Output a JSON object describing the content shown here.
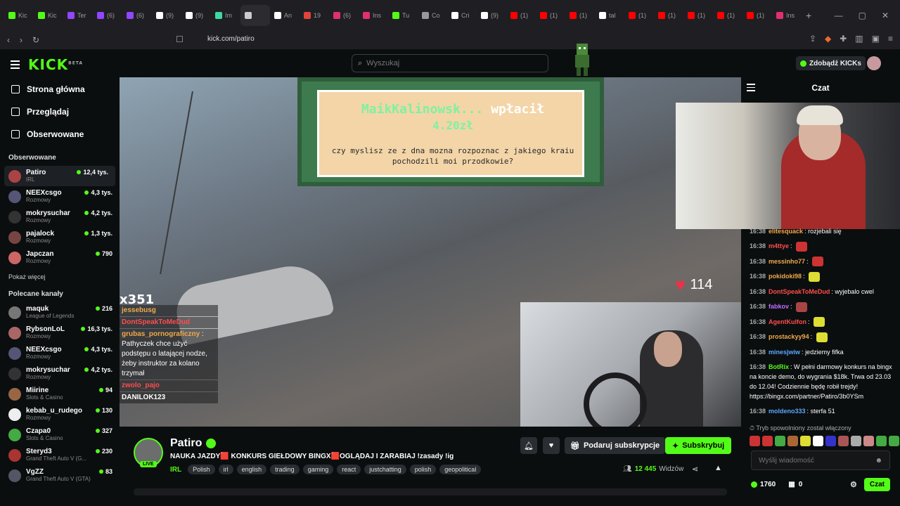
{
  "browser": {
    "tabs": [
      {
        "label": "Kic",
        "color": "#53fc18"
      },
      {
        "label": "Kic",
        "color": "#53fc18"
      },
      {
        "label": "Ter",
        "color": "#9146ff"
      },
      {
        "label": "(6)",
        "color": "#9146ff"
      },
      {
        "label": "(6)",
        "color": "#9146ff"
      },
      {
        "label": "(9)",
        "color": "#ffffff"
      },
      {
        "label": "(9)",
        "color": "#ffffff"
      },
      {
        "label": "Im",
        "color": "#3dd9a0"
      },
      {
        "label": "",
        "color": "#cccccc"
      },
      {
        "label": "An",
        "color": "#ffffff"
      },
      {
        "label": "19",
        "color": "#e0443b"
      },
      {
        "label": "(6)",
        "color": "#e1306c"
      },
      {
        "label": "Ins",
        "color": "#e1306c"
      },
      {
        "label": "Tu",
        "color": "#53fc18"
      },
      {
        "label": "Co",
        "color": "#999999"
      },
      {
        "label": "Cri",
        "color": "#ffffff"
      },
      {
        "label": "(9)",
        "color": "#ffffff"
      },
      {
        "label": "(1)",
        "color": "#ff0000"
      },
      {
        "label": "(1)",
        "color": "#ff0000"
      },
      {
        "label": "(1)",
        "color": "#ff0000"
      },
      {
        "label": "tal",
        "color": "#ffffff"
      },
      {
        "label": "(1)",
        "color": "#ff0000"
      },
      {
        "label": "(1)",
        "color": "#ff0000"
      },
      {
        "label": "(1)",
        "color": "#ff0000"
      },
      {
        "label": "(1)",
        "color": "#ff0000"
      },
      {
        "label": "(1)",
        "color": "#ff0000"
      },
      {
        "label": "Ins",
        "color": "#e1306c"
      }
    ],
    "url": "kick.com/patiro"
  },
  "header": {
    "logo": "KICK",
    "logo_badge": "BETA",
    "search_placeholder": "Wyszukaj",
    "kicks_button": "Zdobądź KICKs"
  },
  "sidebar": {
    "nav": [
      {
        "label": "Strona główna",
        "icon": "home-icon"
      },
      {
        "label": "Przeglądaj",
        "icon": "browse-icon"
      },
      {
        "label": "Obserwowane",
        "icon": "heart-icon"
      }
    ],
    "followed_title": "Obserwowane",
    "followed": [
      {
        "name": "Patiro",
        "category": "IRL",
        "viewers": "12,4 tys.",
        "color": "#a44"
      },
      {
        "name": "NEEXcsgo",
        "category": "Rozmowy",
        "viewers": "4,3 tys.",
        "color": "#557"
      },
      {
        "name": "mokrysuchar",
        "category": "Rozmowy",
        "viewers": "4,2 tys.",
        "color": "#333"
      },
      {
        "name": "pajalock",
        "category": "Rozmowy",
        "viewers": "1,3 tys.",
        "color": "#744"
      },
      {
        "name": "Japczan",
        "category": "Rozmowy",
        "viewers": "790",
        "color": "#c66"
      }
    ],
    "show_more": "Pokaż więcej",
    "recommended_title": "Polecane kanały",
    "recommended": [
      {
        "name": "maquk",
        "category": "League of Legends",
        "viewers": "216",
        "color": "#777"
      },
      {
        "name": "RybsonLoL",
        "category": "Rozmowy",
        "viewers": "16,3 tys.",
        "color": "#a66"
      },
      {
        "name": "NEEXcsgo",
        "category": "Rozmowy",
        "viewers": "4,3 tys.",
        "color": "#557"
      },
      {
        "name": "mokrysuchar",
        "category": "Rozmowy",
        "viewers": "4,2 tys.",
        "color": "#333"
      },
      {
        "name": "Miirine",
        "category": "Slots & Casino",
        "viewers": "94",
        "color": "#964"
      },
      {
        "name": "kebab_u_rudego",
        "category": "Rozmowy",
        "viewers": "130",
        "color": "#eee"
      },
      {
        "name": "Czapa0",
        "category": "Slots & Casino",
        "viewers": "327",
        "color": "#4a4"
      },
      {
        "name": "Steryd3",
        "category": "Grand Theft Auto V (G...",
        "viewers": "230",
        "color": "#a33"
      },
      {
        "name": "VgZZ",
        "category": "Grand Theft Auto V (GTA)",
        "viewers": "83",
        "color": "#556"
      }
    ]
  },
  "video": {
    "alert_name": "MaikKalinowsk...",
    "alert_verb": "wpłacił",
    "alert_amount": "4.20zł",
    "alert_message": "czy myslisz ze z dna mozna rozpoznac z jakiego kraiu pochodzili moi przodkowie?",
    "heart_count": "114",
    "overlay_combo": "x351",
    "overlay_chat": [
      {
        "user": "jessebusg",
        "text": "",
        "user_color": "#f0a94a"
      },
      {
        "user": "DontSpeakToMeDud",
        "text": "",
        "user_color": "#ff4d4d"
      },
      {
        "user": "grubas_pornograficzny",
        "text": "Pathyczek chce użyć podstępu o latającej nodze, żeby instruktor za kolano trzymał",
        "user_color": "#f0a94a"
      },
      {
        "user": "zwolo_pajo",
        "text": "",
        "user_color": "#ff4d4d"
      },
      {
        "user": "DANILOK123",
        "text": "",
        "user_color": "#ffffff"
      }
    ]
  },
  "stream_info": {
    "channel": "Patiro",
    "live": "LIVE",
    "title": "NAUKA JAZDY🟥 KONKURS GIEŁDOWY BINGX🟥OGLĄDAJ I ZARABIAJ !zasady !ig",
    "category": "IRL",
    "tags": [
      "Polish",
      "irl",
      "english",
      "trading",
      "gaming",
      "react",
      "justchatting",
      "polish",
      "geopolitical"
    ],
    "gift_button": "Podaruj subskrypcje",
    "subscribe_button": "Subskrybuj",
    "viewers_count": "12 445",
    "viewers_label": "Widzów"
  },
  "chat": {
    "title": "Czat",
    "messages": [
      {
        "time": "16:38",
        "user": "elitesquack",
        "text": "rozjebali się",
        "color": "#f0a94a",
        "emote": ""
      },
      {
        "time": "16:38",
        "user": "m4ttye",
        "text": "",
        "color": "#ff4d4d",
        "emote": "#c33"
      },
      {
        "time": "16:38",
        "user": "messinho77",
        "text": "",
        "color": "#f0a94a",
        "emote": "#c33"
      },
      {
        "time": "16:38",
        "user": "pokidoki98",
        "text": "",
        "color": "#f0a94a",
        "emote": "#dd3"
      },
      {
        "time": "16:38",
        "user": "DontSpeakToMeDud",
        "text": "wyjebalo cwel",
        "color": "#ff4d4d",
        "emote": ""
      },
      {
        "time": "16:38",
        "user": "fabkov",
        "text": "",
        "color": "#c06bff",
        "emote": "#a44"
      },
      {
        "time": "16:38",
        "user": "AgentKulfon",
        "text": "",
        "color": "#ff4d4d",
        "emote": "#dd3"
      },
      {
        "time": "16:38",
        "user": "prostackyy94",
        "text": "",
        "color": "#f0a94a",
        "emote": "#dd3"
      },
      {
        "time": "16:38",
        "user": "minesjwiw",
        "text": "jedziemy fifka",
        "color": "#5aa8ff",
        "emote": ""
      },
      {
        "time": "16:38",
        "user": "BotRix",
        "text": "W pełni darmowy konkurs na bingx na koncie demo, do wygrania $18k. Trwa od 23.03 do 12.04! Codziennie będę robił trejdy! https://bingx.com/partner/Patiro/3b0YSm",
        "color": "#53fc18",
        "emote": ""
      },
      {
        "time": "16:38",
        "user": "moldeno333",
        "text": "sterfa 51",
        "color": "#5aa8ff",
        "emote": ""
      }
    ],
    "slow_mode": "Tryb spowolniony został włączony",
    "emotes": [
      "#c33",
      "#c33",
      "#4a4",
      "#a63",
      "#dd3",
      "#fff",
      "#33c",
      "#a55",
      "#aaa",
      "#c88",
      "#4a4",
      "#4a4",
      "#eee"
    ],
    "input_placeholder": "Wyślij wiadomość",
    "points": "1760",
    "gifts": "0",
    "send_button": "Czat"
  }
}
